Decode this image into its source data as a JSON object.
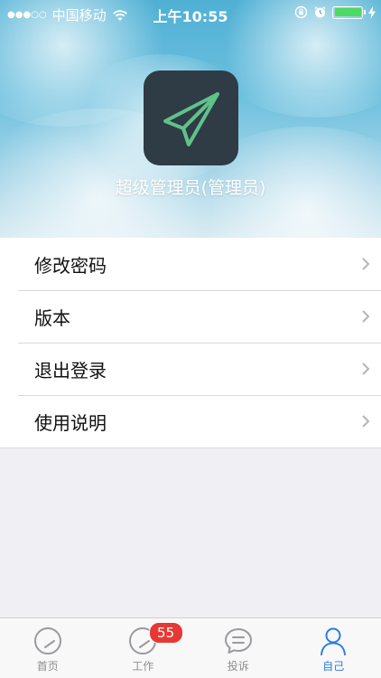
{
  "status_bar": {
    "signal": "●●●○○",
    "carrier": "中国移动",
    "time": "上午10:55"
  },
  "profile": {
    "name": "超级管理员(管理员)"
  },
  "menu": {
    "items": [
      {
        "label": "修改密码"
      },
      {
        "label": "版本"
      },
      {
        "label": "退出登录"
      },
      {
        "label": "使用说明"
      }
    ]
  },
  "tabbar": {
    "tabs": [
      {
        "label": "首页"
      },
      {
        "label": "工作",
        "badge": "55"
      },
      {
        "label": "投诉"
      },
      {
        "label": "自己"
      }
    ],
    "active_index": 3
  },
  "colors": {
    "accent": "#2a7de1",
    "badge": "#e53935",
    "icon_bg": "#2f3b45",
    "icon_line": "#5fc28a"
  },
  "icons": {
    "app": "paper-plane-icon",
    "chevron": "chevron-right-icon",
    "tabs": [
      "compass-icon",
      "compass-icon",
      "chat-bubble-icon",
      "person-icon"
    ]
  }
}
